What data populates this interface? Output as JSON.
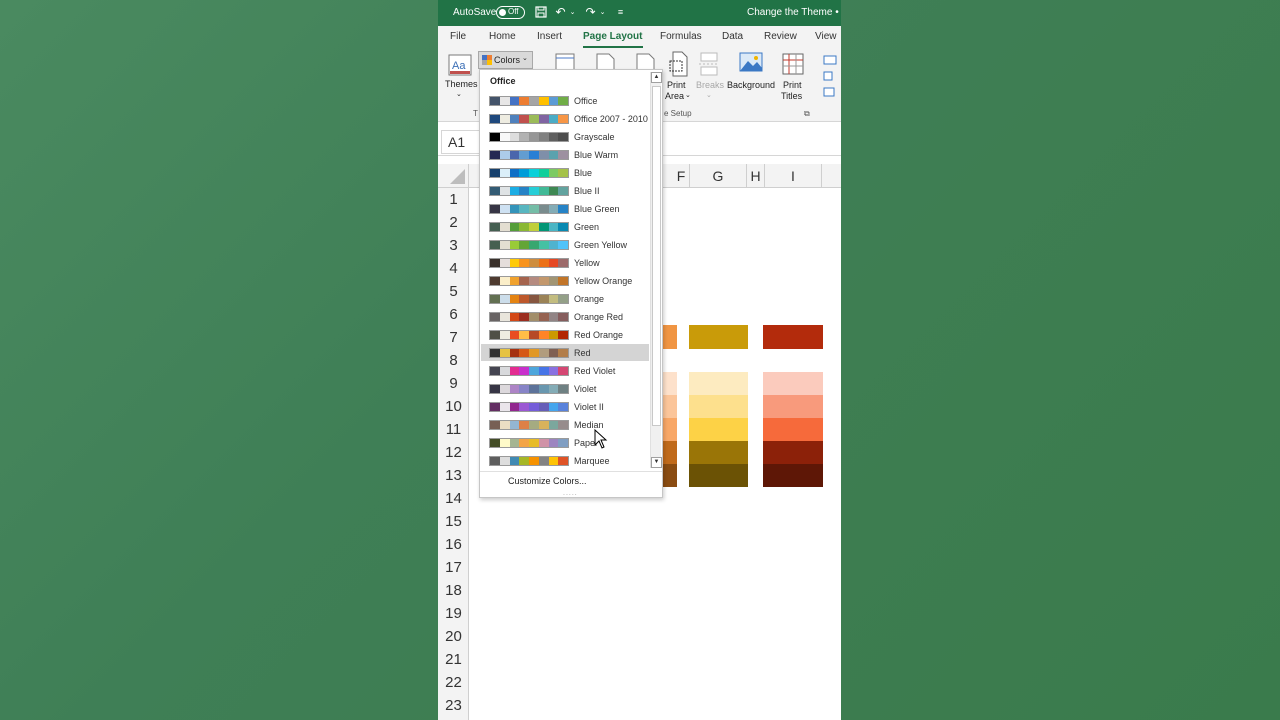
{
  "titlebar": {
    "autosave_label": "AutoSave",
    "autosave_state": "Off",
    "doc_title": "Change the Theme • Sa",
    "icons": [
      "save-icon",
      "undo-icon",
      "redo-icon",
      "customize-qat-icon"
    ]
  },
  "tabs": [
    "File",
    "Home",
    "Insert",
    "Page Layout",
    "Formulas",
    "Data",
    "Review",
    "View"
  ],
  "active_tab": "Page Layout",
  "ribbon": {
    "themes_label": "Themes",
    "colors_label": "Colors",
    "print_area_label": [
      "Print",
      "Area"
    ],
    "breaks_label": "Breaks",
    "background_label": "Background",
    "print_titles_label": [
      "Print",
      "Titles"
    ],
    "group_label": "e Setup",
    "first_group_partial": "T"
  },
  "formula_bar": {
    "name_box": "A1"
  },
  "grid": {
    "columns": [
      "F",
      "G",
      "H",
      "I"
    ],
    "rows": [
      "1",
      "2",
      "3",
      "4",
      "5",
      "6",
      "7",
      "8",
      "9",
      "10",
      "11",
      "12",
      "13",
      "14",
      "15",
      "16",
      "17",
      "18",
      "19",
      "20",
      "21",
      "22",
      "23"
    ]
  },
  "swatches": {
    "g_main": "#c99b09",
    "i_main": "#b32b0c",
    "g_shades": [
      "#fdebc0",
      "#fde08d",
      "#fdd246",
      "#9a7507",
      "#6b5205"
    ],
    "i_shades": [
      "#fbcbbd",
      "#f89a7c",
      "#f66a3b",
      "#8c2109",
      "#5e1706"
    ],
    "f_main": "#f09543",
    "f_shades": [
      "#fde1cb",
      "#fbc59a",
      "#f8a767",
      "#c06a1b",
      "#8a4c12"
    ]
  },
  "dropdown": {
    "header": "Office",
    "themes": [
      {
        "name": "Office",
        "colors": [
          "#44546a",
          "#e7e6e6",
          "#4472c4",
          "#ed7d31",
          "#a5a5a5",
          "#ffc000",
          "#5b9bd5",
          "#70ad47"
        ]
      },
      {
        "name": "Office 2007 - 2010",
        "colors": [
          "#1f497d",
          "#eeece1",
          "#4f81bd",
          "#c0504d",
          "#9bbb59",
          "#8064a2",
          "#4bacc6",
          "#f79646"
        ]
      },
      {
        "name": "Grayscale",
        "colors": [
          "#000000",
          "#f8f8f8",
          "#dddddd",
          "#b2b2b2",
          "#969696",
          "#808080",
          "#5f5f5f",
          "#4d4d4d"
        ]
      },
      {
        "name": "Blue Warm",
        "colors": [
          "#242852",
          "#acccea",
          "#4a66ac",
          "#629dd1",
          "#297fd5",
          "#7f8fa9",
          "#5aa2ae",
          "#9d90a0"
        ]
      },
      {
        "name": "Blue",
        "colors": [
          "#17406d",
          "#dbeff9",
          "#0f6fc6",
          "#009dd9",
          "#0bd0d9",
          "#10cf9b",
          "#7cca62",
          "#a5c249"
        ]
      },
      {
        "name": "Blue II",
        "colors": [
          "#335b74",
          "#dfe3e5",
          "#1cade4",
          "#2683c6",
          "#27ced7",
          "#42ba97",
          "#3e8853",
          "#62a39f"
        ]
      },
      {
        "name": "Blue Green",
        "colors": [
          "#373545",
          "#cee1f2",
          "#3494ba",
          "#58b6c0",
          "#75bda7",
          "#7a8c8e",
          "#84acb6",
          "#2683c6"
        ]
      },
      {
        "name": "Green",
        "colors": [
          "#455f51",
          "#e3ded1",
          "#549e39",
          "#8ab833",
          "#c0cf3a",
          "#029676",
          "#4ab5c4",
          "#0989b1"
        ]
      },
      {
        "name": "Green Yellow",
        "colors": [
          "#455f51",
          "#e3ded1",
          "#99cb38",
          "#63a537",
          "#37a76f",
          "#44c1a3",
          "#4eb3cf",
          "#51c3f9"
        ]
      },
      {
        "name": "Yellow",
        "colors": [
          "#39302a",
          "#e5dedb",
          "#ffca08",
          "#f8931d",
          "#ce8d3e",
          "#ec7016",
          "#e64823",
          "#9c6a6a"
        ]
      },
      {
        "name": "Yellow Orange",
        "colors": [
          "#4e3b30",
          "#fbeec9",
          "#f0a22e",
          "#a5644e",
          "#b58b80",
          "#c3986d",
          "#a19574",
          "#c17529"
        ]
      },
      {
        "name": "Orange",
        "colors": [
          "#637052",
          "#ccddea",
          "#e48312",
          "#bd582c",
          "#865640",
          "#9b8357",
          "#c2bc80",
          "#94a088"
        ]
      },
      {
        "name": "Orange Red",
        "colors": [
          "#696464",
          "#e9e5dc",
          "#d34817",
          "#9b2d1f",
          "#a28e6a",
          "#956251",
          "#918485",
          "#855d5d"
        ]
      },
      {
        "name": "Red Orange",
        "colors": [
          "#505046",
          "#eeece1",
          "#e84c22",
          "#ffbd47",
          "#b64926",
          "#ff8427",
          "#cc9900",
          "#b22600"
        ]
      },
      {
        "name": "Red",
        "colors": [
          "#323232",
          "#e5c243",
          "#a5300f",
          "#d55816",
          "#e19825",
          "#b19c7d",
          "#7f5f52",
          "#b27d49"
        ]
      },
      {
        "name": "Red Violet",
        "colors": [
          "#454551",
          "#d8d9dc",
          "#e32d91",
          "#c830cc",
          "#4ea6dc",
          "#4775e7",
          "#8971e1",
          "#d54773"
        ]
      },
      {
        "name": "Violet",
        "colors": [
          "#373545",
          "#dcd8dc",
          "#ad84c6",
          "#8784c7",
          "#5d739a",
          "#6997af",
          "#84acb6",
          "#6f8183"
        ]
      },
      {
        "name": "Violet II",
        "colors": [
          "#632e62",
          "#eae5eb",
          "#92278f",
          "#9b57d3",
          "#755dd9",
          "#665eb8",
          "#45a5ed",
          "#5982db"
        ]
      },
      {
        "name": "Median",
        "colors": [
          "#775f55",
          "#ebddc3",
          "#94b6d2",
          "#dd8047",
          "#a5ab81",
          "#d8b25c",
          "#7ba79d",
          "#968c8c"
        ]
      },
      {
        "name": "Paper",
        "colors": [
          "#444d26",
          "#fefac9",
          "#a5b592",
          "#f3a447",
          "#e7bc29",
          "#d092a7",
          "#9c85c0",
          "#809ec2"
        ]
      },
      {
        "name": "Marquee",
        "colors": [
          "#5e5e5e",
          "#dddddd",
          "#418ab3",
          "#a6b727",
          "#f69200",
          "#838383",
          "#fec306",
          "#df5327"
        ]
      }
    ],
    "selected": "Red",
    "customize_label": "Customize Colors...",
    "grip": "....."
  }
}
